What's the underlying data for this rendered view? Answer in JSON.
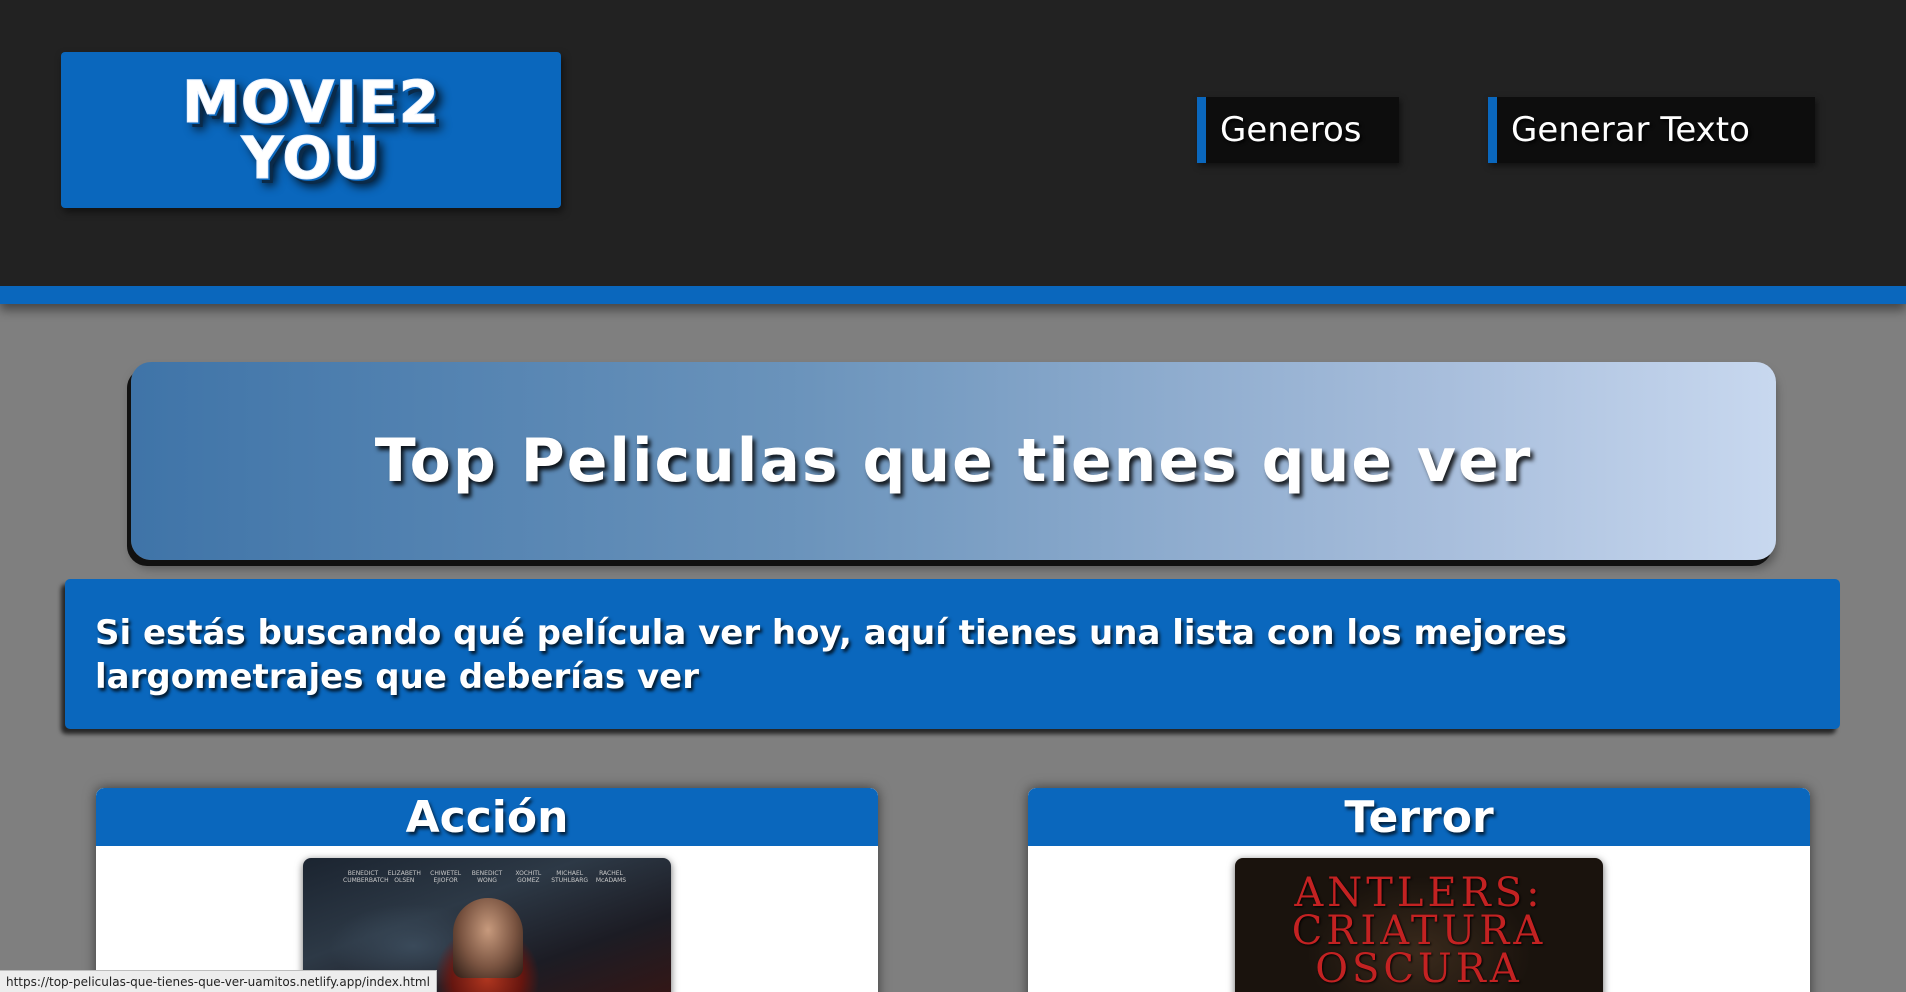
{
  "header": {
    "logo": {
      "line1": "MOVIE2",
      "line2": "YOU"
    },
    "nav": [
      {
        "label": "Generos"
      },
      {
        "label": "Generar Texto"
      }
    ],
    "accent_color": "#0a67bd",
    "background_color": "#222222"
  },
  "hero": {
    "title": "Top Peliculas que tienes que ver"
  },
  "intro": {
    "text": "Si estás buscando qué película ver hoy, aquí tienes una lista con los mejores largometrajes que deberías ver"
  },
  "categories": [
    {
      "title": "Acción",
      "poster": {
        "credits": [
          "BENEDICT CUMBERBATCH",
          "ELIZABETH OLSEN",
          "CHIWETEL EJIOFOR",
          "BENEDICT WONG",
          "XOCHITL GOMEZ",
          "MICHAEL STUHLBARG",
          "RACHEL McADAMS"
        ]
      }
    },
    {
      "title": "Terror",
      "poster": {
        "title_line1": "ANTLERS:",
        "title_line2": "CRIATURA",
        "title_line3": "OSCURA"
      }
    }
  ],
  "status_bar": {
    "url": "https://top-peliculas-que-tienes-que-ver-uamitos.netlify.app/index.html"
  }
}
